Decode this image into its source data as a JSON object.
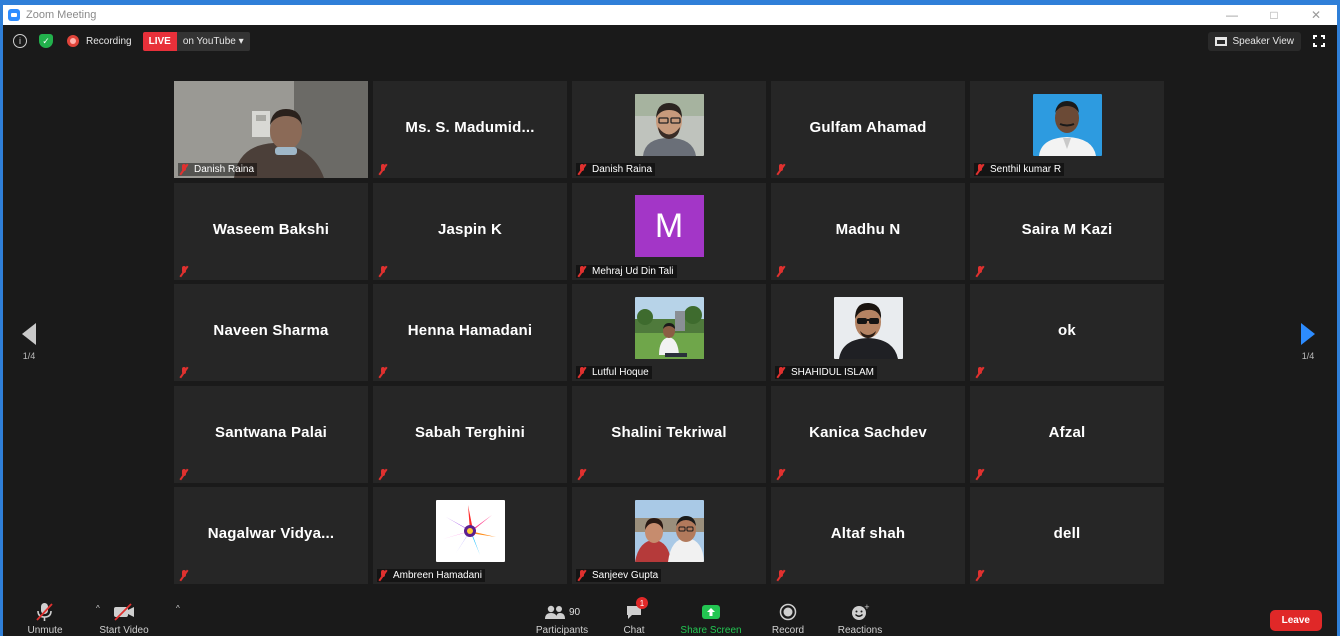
{
  "window": {
    "title": "Zoom Meeting"
  },
  "topbar": {
    "recording_label": "Recording",
    "live_label": "LIVE",
    "live_target": "on YouTube",
    "speaker_view_label": "Speaker View"
  },
  "pagination": {
    "left": "1/4",
    "right": "1/4"
  },
  "tiles": [
    {
      "name": "",
      "footer": "Danish Raina",
      "kind": "video"
    },
    {
      "name": "Ms. S. Madumid...",
      "footer": "",
      "kind": "name"
    },
    {
      "name": "",
      "footer": "Danish Raina",
      "kind": "photo",
      "photo": "man-glasses"
    },
    {
      "name": "Gulfam Ahamad",
      "footer": "",
      "kind": "name"
    },
    {
      "name": "",
      "footer": "Senthil kumar R",
      "kind": "photo",
      "photo": "man-blue"
    },
    {
      "name": "Waseem Bakshi",
      "footer": "",
      "kind": "name"
    },
    {
      "name": "Jaspin K",
      "footer": "",
      "kind": "name"
    },
    {
      "name": "M",
      "footer": "Mehraj Ud Din Tali",
      "kind": "letter"
    },
    {
      "name": "Madhu N",
      "footer": "",
      "kind": "name"
    },
    {
      "name": "Saira M Kazi",
      "footer": "",
      "kind": "name"
    },
    {
      "name": "Naveen Sharma",
      "footer": "",
      "kind": "name"
    },
    {
      "name": "Henna Hamadani",
      "footer": "",
      "kind": "name"
    },
    {
      "name": "",
      "footer": "Lutful Hoque",
      "kind": "photo",
      "photo": "man-garden"
    },
    {
      "name": "",
      "footer": "SHAHIDUL ISLAM",
      "kind": "photo",
      "photo": "man-sunglasses"
    },
    {
      "name": "ok",
      "footer": "",
      "kind": "name"
    },
    {
      "name": "Santwana Palai",
      "footer": "",
      "kind": "name"
    },
    {
      "name": "Sabah Terghini",
      "footer": "",
      "kind": "name"
    },
    {
      "name": "Shalini Tekriwal",
      "footer": "",
      "kind": "name"
    },
    {
      "name": "Kanica Sachdev",
      "footer": "",
      "kind": "name"
    },
    {
      "name": "Afzal",
      "footer": "",
      "kind": "name"
    },
    {
      "name": "Nagalwar  Vidya...",
      "footer": "",
      "kind": "name"
    },
    {
      "name": "",
      "footer": "Ambreen Hamadani",
      "kind": "photo",
      "photo": "color-burst"
    },
    {
      "name": "",
      "footer": "Sanjeev Gupta",
      "kind": "photo",
      "photo": "couple"
    },
    {
      "name": "Altaf shah",
      "footer": "",
      "kind": "name"
    },
    {
      "name": "dell",
      "footer": "",
      "kind": "name"
    }
  ],
  "toolbar": {
    "unmute": "Unmute",
    "start_video": "Start Video",
    "participants": "Participants",
    "participants_count": "90",
    "chat": "Chat",
    "chat_badge": "1",
    "share_screen": "Share Screen",
    "record": "Record",
    "reactions": "Reactions",
    "leave": "Leave"
  },
  "colors": {
    "accent": "#2d8cff",
    "live": "#e8303a",
    "share": "#23c552",
    "leave": "#e02828",
    "tile_bg": "#262626"
  }
}
